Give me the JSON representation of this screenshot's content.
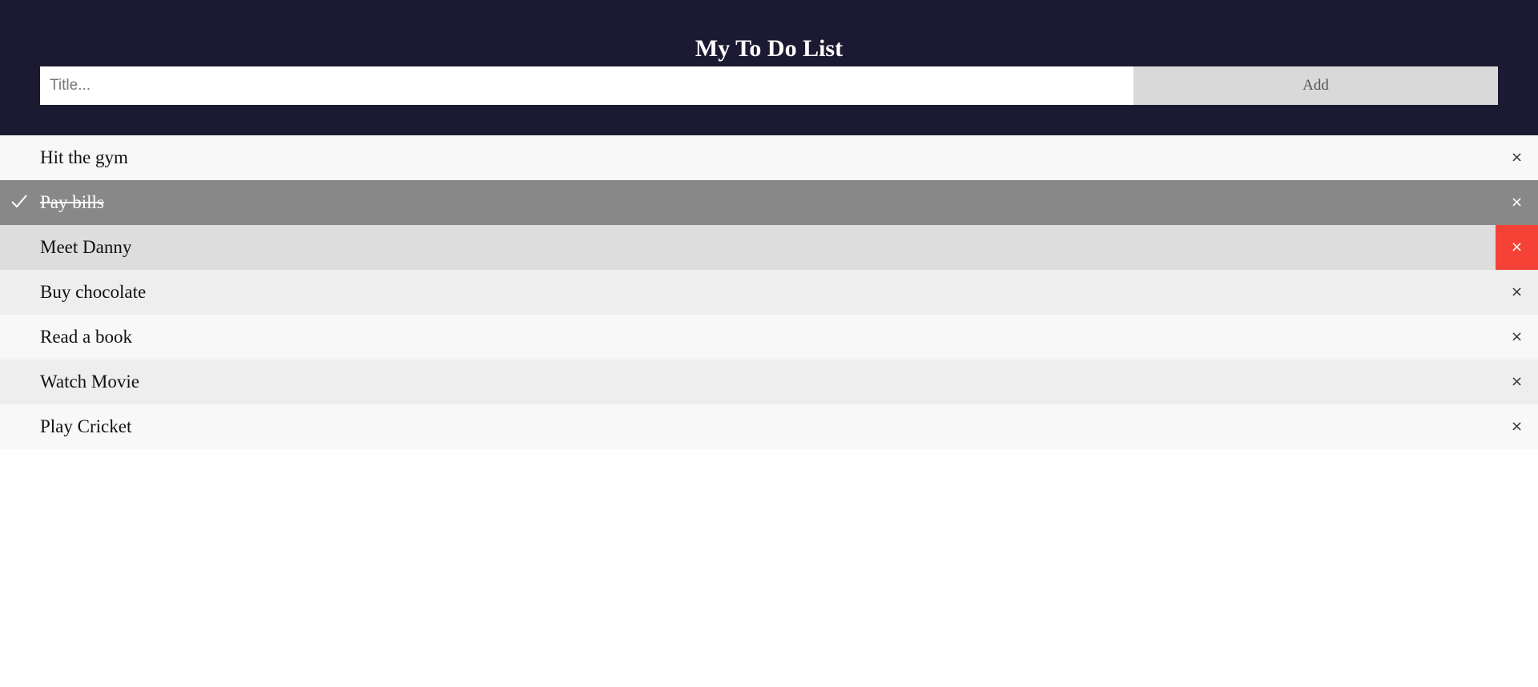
{
  "header": {
    "title": "My To Do List",
    "input_placeholder": "Title...",
    "input_value": "",
    "add_label": "Add"
  },
  "colors": {
    "header_bg": "#1c1a33",
    "checked_bg": "#888888",
    "close_hover_bg": "#f44336",
    "add_button_bg": "#d9d9d9"
  },
  "todos": [
    {
      "text": "Hit the gym",
      "checked": false,
      "close": "×"
    },
    {
      "text": "Pay bills",
      "checked": true,
      "close": "×"
    },
    {
      "text": "Meet Danny",
      "checked": false,
      "hovered": true,
      "close": "×"
    },
    {
      "text": "Buy chocolate",
      "checked": false,
      "close": "×"
    },
    {
      "text": "Read a book",
      "checked": false,
      "close": "×"
    },
    {
      "text": "Watch Movie",
      "checked": false,
      "close": "×"
    },
    {
      "text": "Play Cricket",
      "checked": false,
      "close": "×"
    }
  ],
  "icons": {
    "check": "check-icon",
    "close": "close-icon"
  }
}
